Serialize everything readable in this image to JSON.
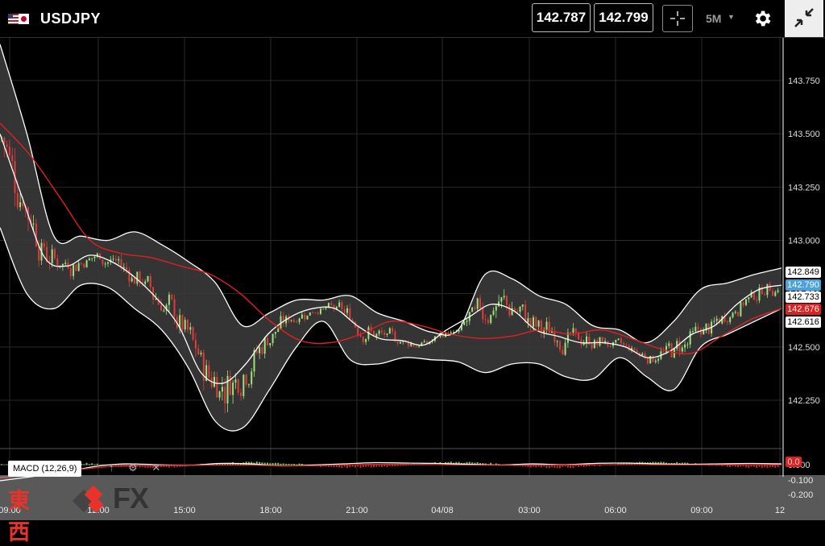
{
  "header": {
    "symbol": "USDJPY",
    "bid": "142.787",
    "ask": "142.799",
    "timeframe": "5M",
    "icons": [
      "flag-us-jp-icon",
      "crosshair-icon",
      "chevron-down-icon",
      "gear-icon",
      "collapse-icon"
    ]
  },
  "chart_data": {
    "type": "line",
    "title": "",
    "y_axis": {
      "ticks": [
        "143.750",
        "143.500",
        "143.250",
        "143.000",
        "142.750",
        "142.500",
        "142.250"
      ],
      "range": [
        142.07,
        143.99
      ]
    },
    "x_axis": {
      "ticks": [
        "09:00",
        "12:00",
        "15:00",
        "18:00",
        "21:00",
        "04/08",
        "03:00",
        "06:00",
        "09:00",
        "12"
      ]
    },
    "price_tags": [
      {
        "value": "142.849",
        "color": "white"
      },
      {
        "value": "142.790",
        "color": "blue"
      },
      {
        "value": "142.733",
        "color": "white"
      },
      {
        "value": "142.676",
        "color": "red"
      },
      {
        "value": "142.616",
        "color": "white"
      }
    ],
    "series": [
      {
        "role": "bollinger-middle",
        "color": "#ffffff",
        "y": [
          143.5,
          143.2,
          142.92,
          142.88,
          142.93,
          142.9,
          142.83,
          142.73,
          142.6,
          142.38,
          142.33,
          142.42,
          142.56,
          142.64,
          142.68,
          142.68,
          142.6,
          142.54,
          142.53,
          142.51,
          142.58,
          142.64,
          142.7,
          142.67,
          142.58,
          142.55,
          142.52,
          142.52,
          142.5,
          142.45,
          142.48,
          142.56,
          142.6,
          142.7,
          142.77,
          142.79
        ]
      },
      {
        "role": "bollinger-upper",
        "color": "#ffffff",
        "y": [
          143.92,
          143.5,
          143.02,
          143.02,
          143.0,
          143.04,
          142.98,
          142.9,
          142.8,
          142.6,
          142.66,
          142.72,
          142.72,
          142.74,
          142.66,
          142.62,
          142.57,
          142.58,
          142.84,
          142.82,
          142.74,
          142.7,
          142.6,
          142.58,
          142.52,
          142.62,
          142.77,
          142.8,
          142.84,
          142.87
        ]
      },
      {
        "role": "bollinger-lower",
        "color": "#ffffff",
        "y": [
          143.06,
          142.75,
          142.68,
          142.79,
          142.78,
          142.68,
          142.58,
          142.4,
          142.15,
          142.12,
          142.3,
          142.5,
          142.62,
          142.44,
          142.42,
          142.45,
          142.44,
          142.43,
          142.38,
          142.42,
          142.42,
          142.36,
          142.35,
          142.45,
          142.36,
          142.3,
          142.5,
          142.56,
          142.62,
          142.68
        ]
      },
      {
        "role": "moving-average",
        "color": "#e02020",
        "y": [
          143.55,
          143.4,
          143.2,
          143.0,
          142.94,
          142.92,
          142.88,
          142.84,
          142.75,
          142.62,
          142.53,
          142.52,
          142.56,
          142.62,
          142.6,
          142.56,
          142.54,
          142.55,
          142.58,
          142.56,
          142.58,
          142.54,
          142.49,
          142.47,
          142.55,
          142.63,
          142.68
        ]
      }
    ],
    "macd": {
      "label": "MACD (12,26,9)",
      "ticks": [
        "0.000",
        "-0.100",
        "-0.200"
      ],
      "tag": "0.0",
      "icons": [
        "arrow-up-icon",
        "gear-icon",
        "close-icon"
      ]
    }
  },
  "branding": {
    "kanji": "東西",
    "fx": "FX"
  },
  "colors": {
    "bg": "#000000",
    "band_fill": "#3a3a3a",
    "up_candle": "#9be37a",
    "down_candle": "#e03b3b",
    "ma": "#e02020",
    "tag_blue": "#4aa3df",
    "tag_red": "#e02020"
  }
}
